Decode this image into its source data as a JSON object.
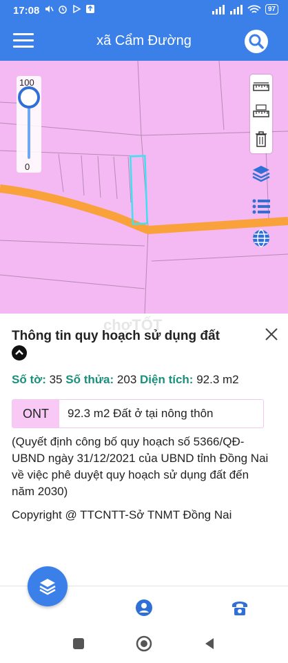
{
  "status_bar": {
    "time": "17:08",
    "battery": "97"
  },
  "app_bar": {
    "title": "xã Cẩm Đường"
  },
  "map": {
    "slider": {
      "max_label": "100",
      "min_label": "0",
      "level": 1.0
    },
    "colors": {
      "land": "#f4b8f2",
      "road": "#f9a23c",
      "selected": "#3fe0f0"
    }
  },
  "info": {
    "title": "Thông tin quy hoạch sử dụng đất",
    "sheet_label": "Số tờ:",
    "sheet_value": "35",
    "plot_label": "Số thửa:",
    "plot_value": "203",
    "area_label": "Diện tích:",
    "area_value": "92.3 m2",
    "land_code": "ONT",
    "land_desc": "92.3 m2 Đất ở tại nông thôn",
    "decision": "(Quyết định công bố quy hoạch số 5366/QĐ-UBND ngày 31/12/2021 của UBND tỉnh Đồng Nai về việc phê duyệt quy hoạch sử dụng đất đến năm 2030)",
    "copyright": "Copyright @ TTCNTT-Sở TNMT Đồng Nai",
    "watermark": "chợTỐT"
  }
}
